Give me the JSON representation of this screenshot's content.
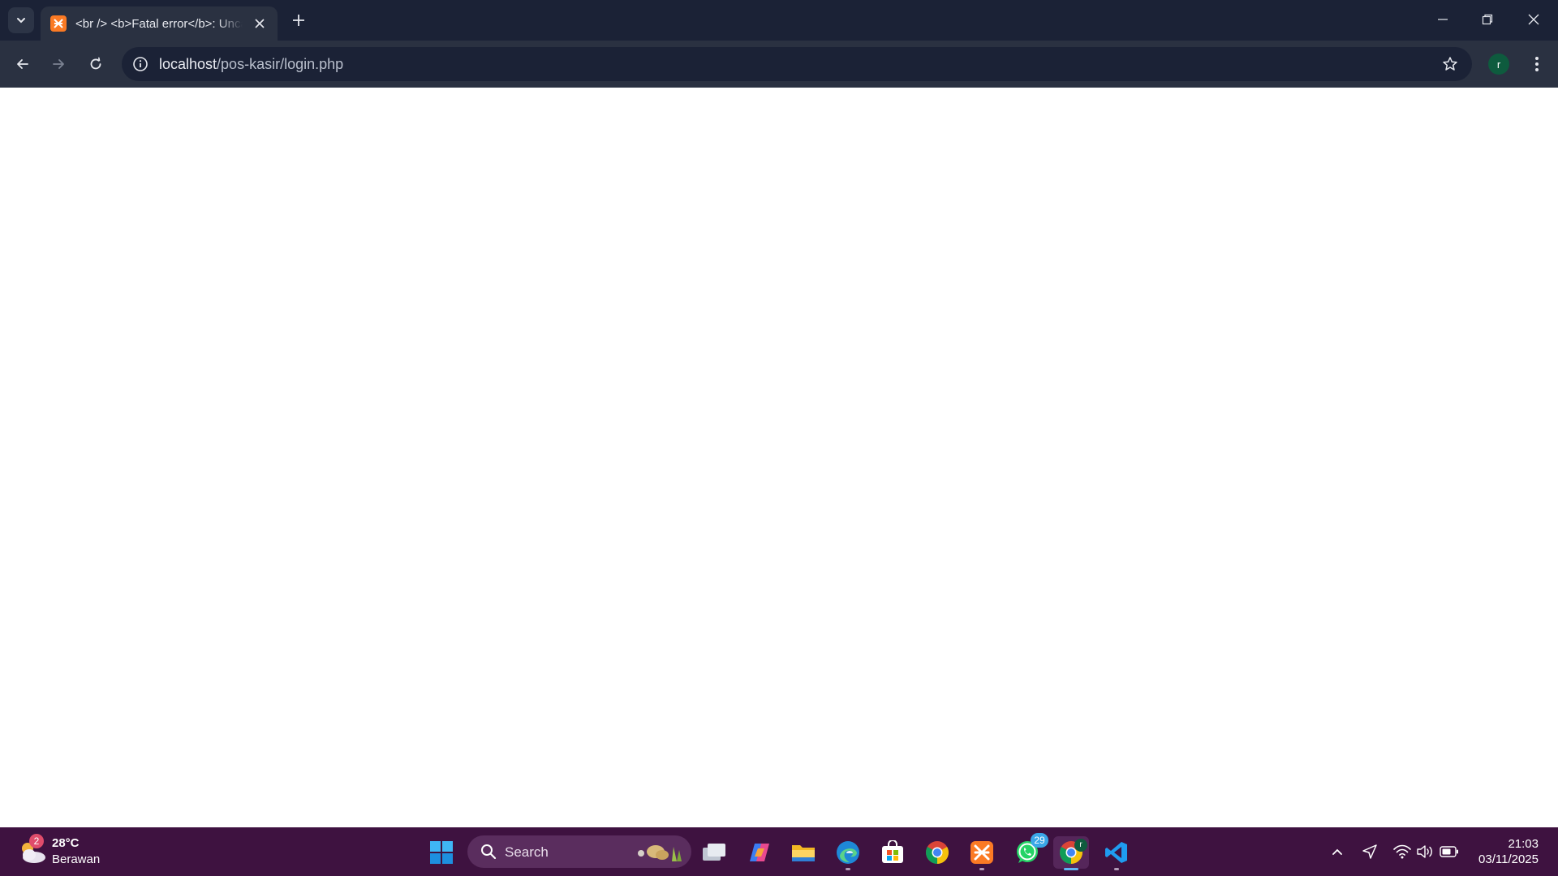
{
  "browser": {
    "tab": {
      "title": "<br /> <b>Fatal error</b>: Uncaught"
    },
    "address": {
      "host": "localhost",
      "path": "/pos-kasir/login.php"
    },
    "profile_initial": "r"
  },
  "taskbar": {
    "weather": {
      "temp": "28°C",
      "desc": "Berawan",
      "badge": "2"
    },
    "search": {
      "label": "Search"
    },
    "whatsapp_badge": "29",
    "chrome_profile_initial": "r",
    "clock": {
      "time": "21:03",
      "date": "03/11/2025"
    }
  },
  "colors": {
    "tabstrip": "#1b2236",
    "toolbar": "#2a3141",
    "taskbar": "#3e1240",
    "xampp": "#fb7a24"
  }
}
